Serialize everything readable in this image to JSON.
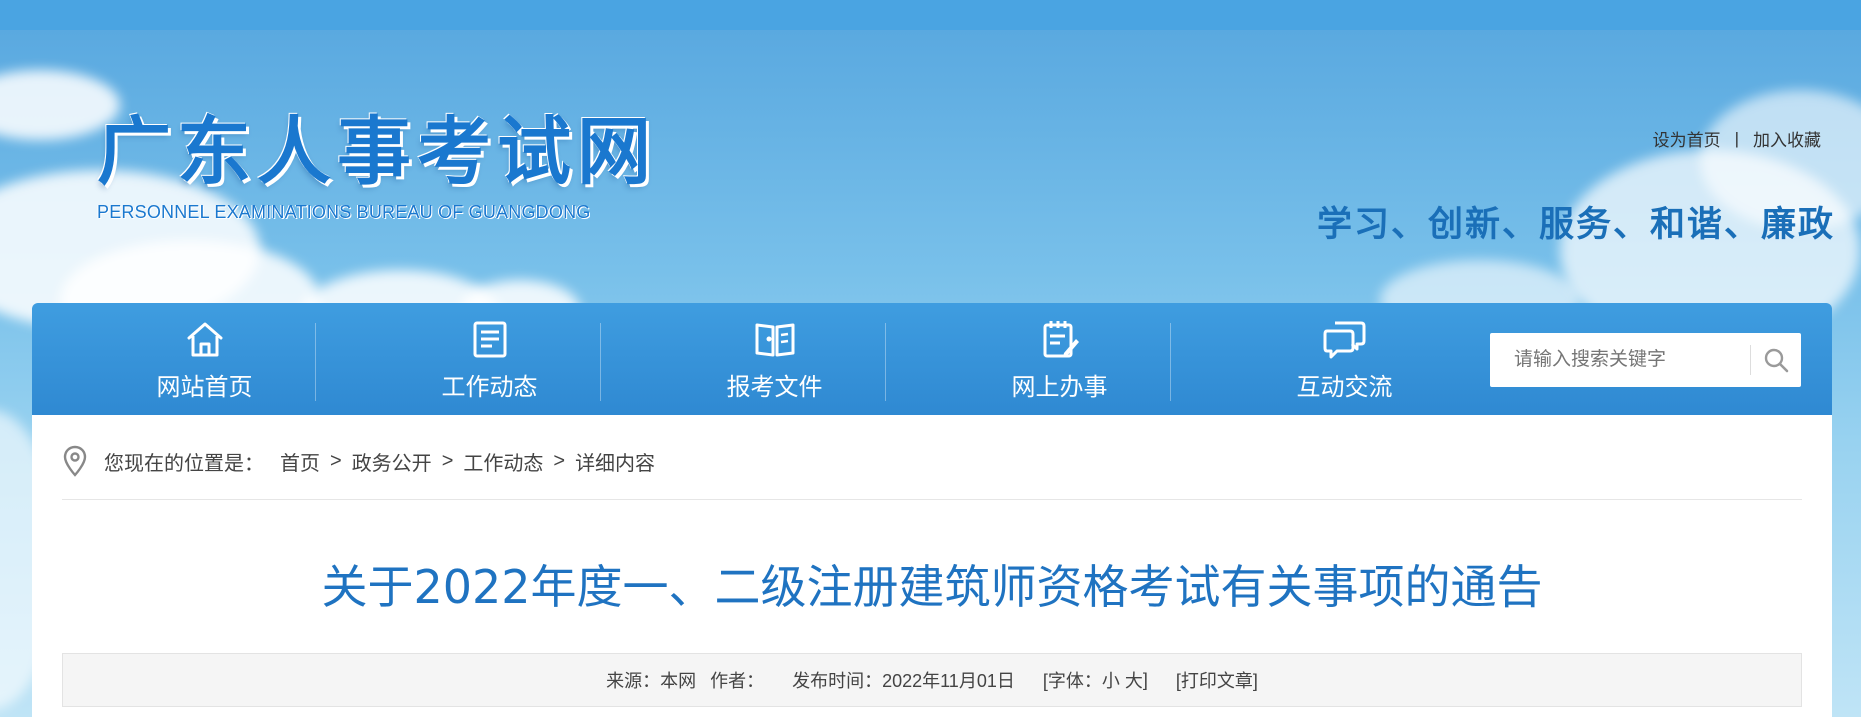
{
  "header": {
    "logo_cn": "广东人事考试网",
    "logo_en": "PERSONNEL EXAMINATIONS BUREAU OF GUANGDONG",
    "links": {
      "set_home": "设为首页",
      "separator": "|",
      "favorite": "加入收藏"
    },
    "slogan": "学习、创新、服务、和谐、廉政"
  },
  "nav": {
    "items": [
      {
        "label": "网站首页",
        "icon": "home-icon"
      },
      {
        "label": "工作动态",
        "icon": "news-list-icon"
      },
      {
        "label": "报考文件",
        "icon": "document-book-icon"
      },
      {
        "label": "网上办事",
        "icon": "clipboard-edit-icon"
      },
      {
        "label": "互动交流",
        "icon": "chat-bubbles-icon"
      }
    ],
    "search": {
      "placeholder": "请输入搜索关键字",
      "icon": "search-icon"
    }
  },
  "breadcrumb": {
    "icon": "location-pin-icon",
    "prefix": "您现在的位置是：",
    "items": [
      "首页",
      "政务公开",
      "工作动态",
      "详细内容"
    ],
    "separator": ">"
  },
  "article": {
    "title": "关于2022年度一、二级注册建筑师资格考试有关事项的通告",
    "meta": {
      "source_label": "来源：",
      "source": "本网",
      "author_label": "作者：",
      "date_label": "发布时间：",
      "date": "2022年11月01日",
      "font_label": "[字体：",
      "font_small": "小",
      "font_large": "大",
      "font_close": "]",
      "print": "[打印文章]"
    }
  },
  "colors": {
    "brand_blue": "#1a78cf",
    "nav_blue": "#2f89d2",
    "title_blue": "#1f73c1",
    "slogan_blue": "#1a6fb8"
  }
}
